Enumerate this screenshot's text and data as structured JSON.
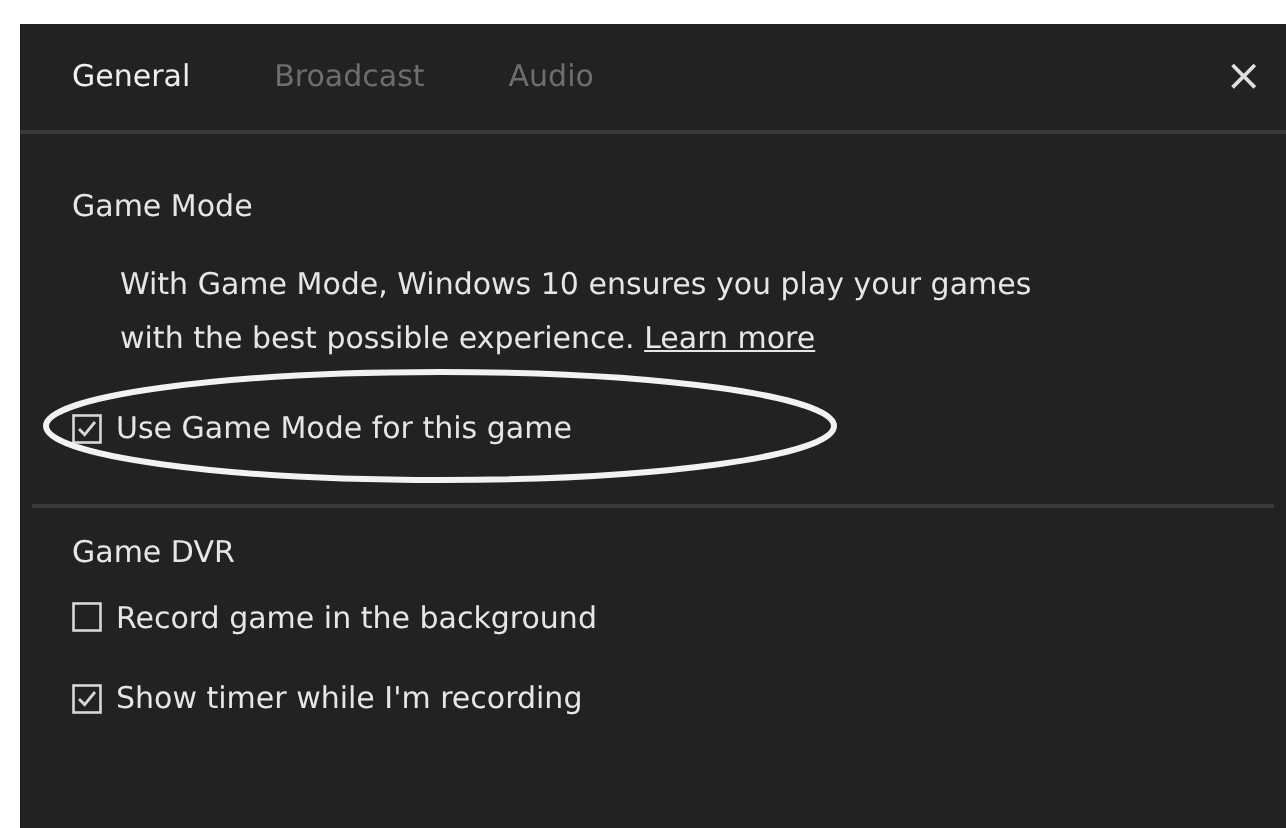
{
  "tabs": [
    {
      "label": "General",
      "selected": true
    },
    {
      "label": "Broadcast",
      "selected": false
    },
    {
      "label": "Audio",
      "selected": false
    }
  ],
  "close": "×",
  "sections": [
    {
      "title": "Game Mode",
      "description": "With Game Mode, Windows 10 ensures you play your games with the best possible experience.",
      "link": "Learn more",
      "options": [
        {
          "label": "Use Game Mode for this game",
          "checked": true,
          "highlighted": true
        }
      ]
    },
    {
      "title": "Game DVR",
      "options": [
        {
          "label": "Record game in the background",
          "checked": false,
          "highlighted": false
        },
        {
          "label": "Show timer while I'm recording",
          "checked": true,
          "highlighted": false
        }
      ]
    }
  ]
}
